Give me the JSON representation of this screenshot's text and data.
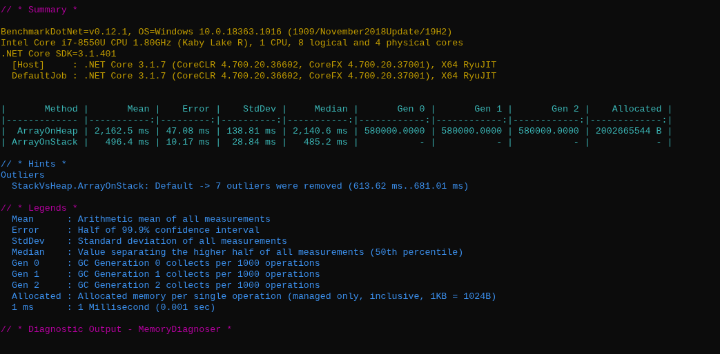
{
  "console_lines": [
    {
      "kind": "header",
      "text": "// * Summary *"
    },
    {
      "kind": "blank"
    },
    {
      "kind": "info",
      "text": "BenchmarkDotNet=v0.12.1, OS=Windows 10.0.18363.1016 (1909/November2018Update/19H2)"
    },
    {
      "kind": "info",
      "text": "Intel Core i7-8550U CPU 1.80GHz (Kaby Lake R), 1 CPU, 8 logical and 4 physical cores"
    },
    {
      "kind": "info",
      "text": ".NET Core SDK=3.1.401"
    },
    {
      "kind": "info",
      "text": "  [Host]     : .NET Core 3.1.7 (CoreCLR 4.700.20.36602, CoreFX 4.700.20.37001), X64 RyuJIT"
    },
    {
      "kind": "info",
      "text": "  DefaultJob : .NET Core 3.1.7 (CoreCLR 4.700.20.36602, CoreFX 4.700.20.37001), X64 RyuJIT"
    },
    {
      "kind": "blank"
    },
    {
      "kind": "blank"
    },
    {
      "kind": "table",
      "text": "|       Method |       Mean |    Error |    StdDev |     Median |       Gen 0 |       Gen 1 |       Gen 2 |    Allocated |"
    },
    {
      "kind": "table",
      "text": "|------------- |-----------:|---------:|----------:|-----------:|------------:|------------:|------------:|-------------:|"
    },
    {
      "kind": "table",
      "text": "|  ArrayOnHeap | 2,162.5 ms | 47.08 ms | 138.81 ms | 2,140.6 ms | 580000.0000 | 580000.0000 | 580000.0000 | 2002665544 B |"
    },
    {
      "kind": "table",
      "text": "| ArrayOnStack |   496.4 ms | 10.17 ms |  28.84 ms |   485.2 ms |           - |           - |           - |            - |"
    },
    {
      "kind": "blank"
    },
    {
      "kind": "hint",
      "text": "// * Hints *"
    },
    {
      "kind": "hint",
      "text": "Outliers"
    },
    {
      "kind": "hint",
      "text": "  StackVsHeap.ArrayOnStack: Default -> 7 outliers were removed (613.62 ms..681.01 ms)"
    },
    {
      "kind": "blank"
    },
    {
      "kind": "header",
      "text": "// * Legends *"
    },
    {
      "kind": "hint",
      "text": "  Mean      : Arithmetic mean of all measurements"
    },
    {
      "kind": "hint",
      "text": "  Error     : Half of 99.9% confidence interval"
    },
    {
      "kind": "hint",
      "text": "  StdDev    : Standard deviation of all measurements"
    },
    {
      "kind": "hint",
      "text": "  Median    : Value separating the higher half of all measurements (50th percentile)"
    },
    {
      "kind": "hint",
      "text": "  Gen 0     : GC Generation 0 collects per 1000 operations"
    },
    {
      "kind": "hint",
      "text": "  Gen 1     : GC Generation 1 collects per 1000 operations"
    },
    {
      "kind": "hint",
      "text": "  Gen 2     : GC Generation 2 collects per 1000 operations"
    },
    {
      "kind": "hint",
      "text": "  Allocated : Allocated memory per single operation (managed only, inclusive, 1KB = 1024B)"
    },
    {
      "kind": "hint",
      "text": "  1 ms      : 1 Millisecond (0.001 sec)"
    },
    {
      "kind": "blank"
    },
    {
      "kind": "header",
      "text": "// * Diagnostic Output - MemoryDiagnoser *"
    }
  ]
}
